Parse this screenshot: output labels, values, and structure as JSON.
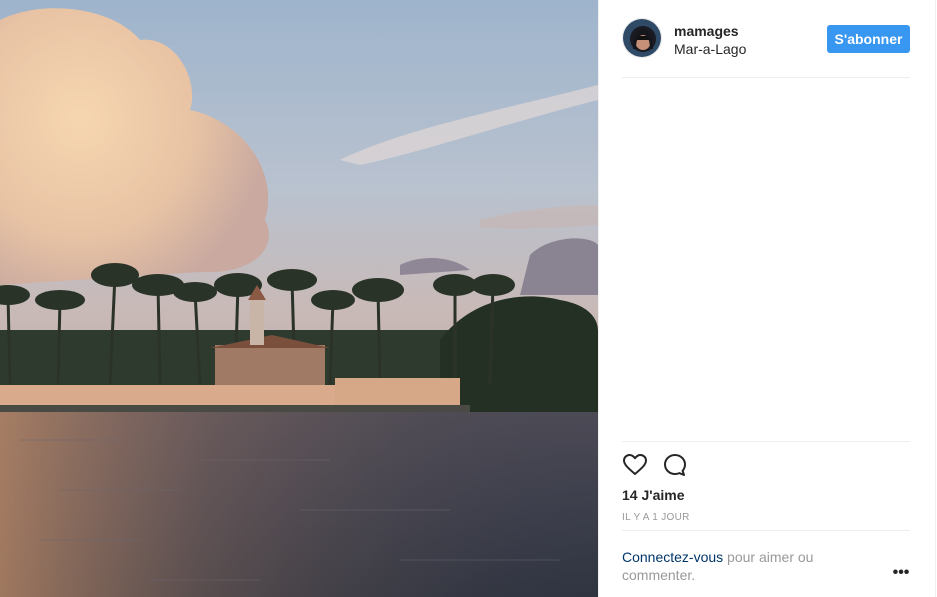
{
  "post": {
    "image_icon": "photo-of-waterfront-estate-at-sunset"
  },
  "header": {
    "avatar_icon": "user-avatar",
    "username": "mamages",
    "location": "Mar-a-Lago",
    "follow_label": "S'abonner"
  },
  "actions": {
    "like_icon": "heart-icon",
    "comment_icon": "comment-icon"
  },
  "likes_text": "14 J'aime",
  "timestamp": "IL Y A 1 JOUR",
  "login": {
    "link_text": "Connectez-vous",
    "rest_text": " pour aimer ou commenter."
  },
  "more_label": "•••",
  "colors": {
    "accent": "#3897f0",
    "link": "#003569",
    "muted": "#999999",
    "text": "#262626"
  }
}
